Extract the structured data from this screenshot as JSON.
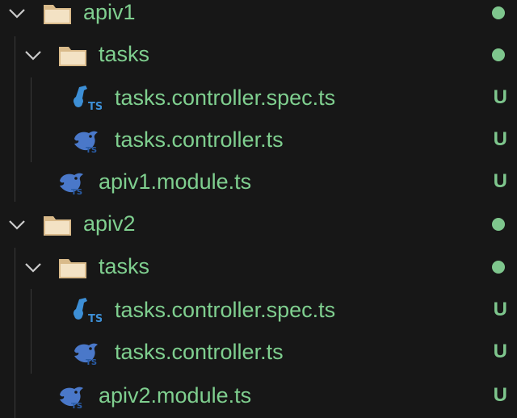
{
  "colors": {
    "background": "#171717",
    "text": "#7fcf8f",
    "folder": "#d9ba8a",
    "nest_icon": "#4a90d9",
    "guide": "#3a3a3a"
  },
  "tree": [
    {
      "type": "folder",
      "label": "apiv1",
      "status": "dot",
      "icon": "folder-icon",
      "expanded": true
    },
    {
      "type": "folder",
      "label": "tasks",
      "status": "dot",
      "icon": "folder-icon",
      "expanded": true
    },
    {
      "type": "file",
      "label": "tasks.controller.spec.ts",
      "status": "U",
      "icon": "test-file-icon"
    },
    {
      "type": "file",
      "label": "tasks.controller.ts",
      "status": "U",
      "icon": "nestjs-file-icon"
    },
    {
      "type": "file",
      "label": "apiv1.module.ts",
      "status": "U",
      "icon": "nestjs-file-icon"
    },
    {
      "type": "folder",
      "label": "apiv2",
      "status": "dot",
      "icon": "folder-icon",
      "expanded": true
    },
    {
      "type": "folder",
      "label": "tasks",
      "status": "dot",
      "icon": "folder-icon",
      "expanded": true
    },
    {
      "type": "file",
      "label": "tasks.controller.spec.ts",
      "status": "U",
      "icon": "test-file-icon"
    },
    {
      "type": "file",
      "label": "tasks.controller.ts",
      "status": "U",
      "icon": "nestjs-file-icon"
    },
    {
      "type": "file",
      "label": "apiv2.module.ts",
      "status": "U",
      "icon": "nestjs-file-icon"
    }
  ]
}
